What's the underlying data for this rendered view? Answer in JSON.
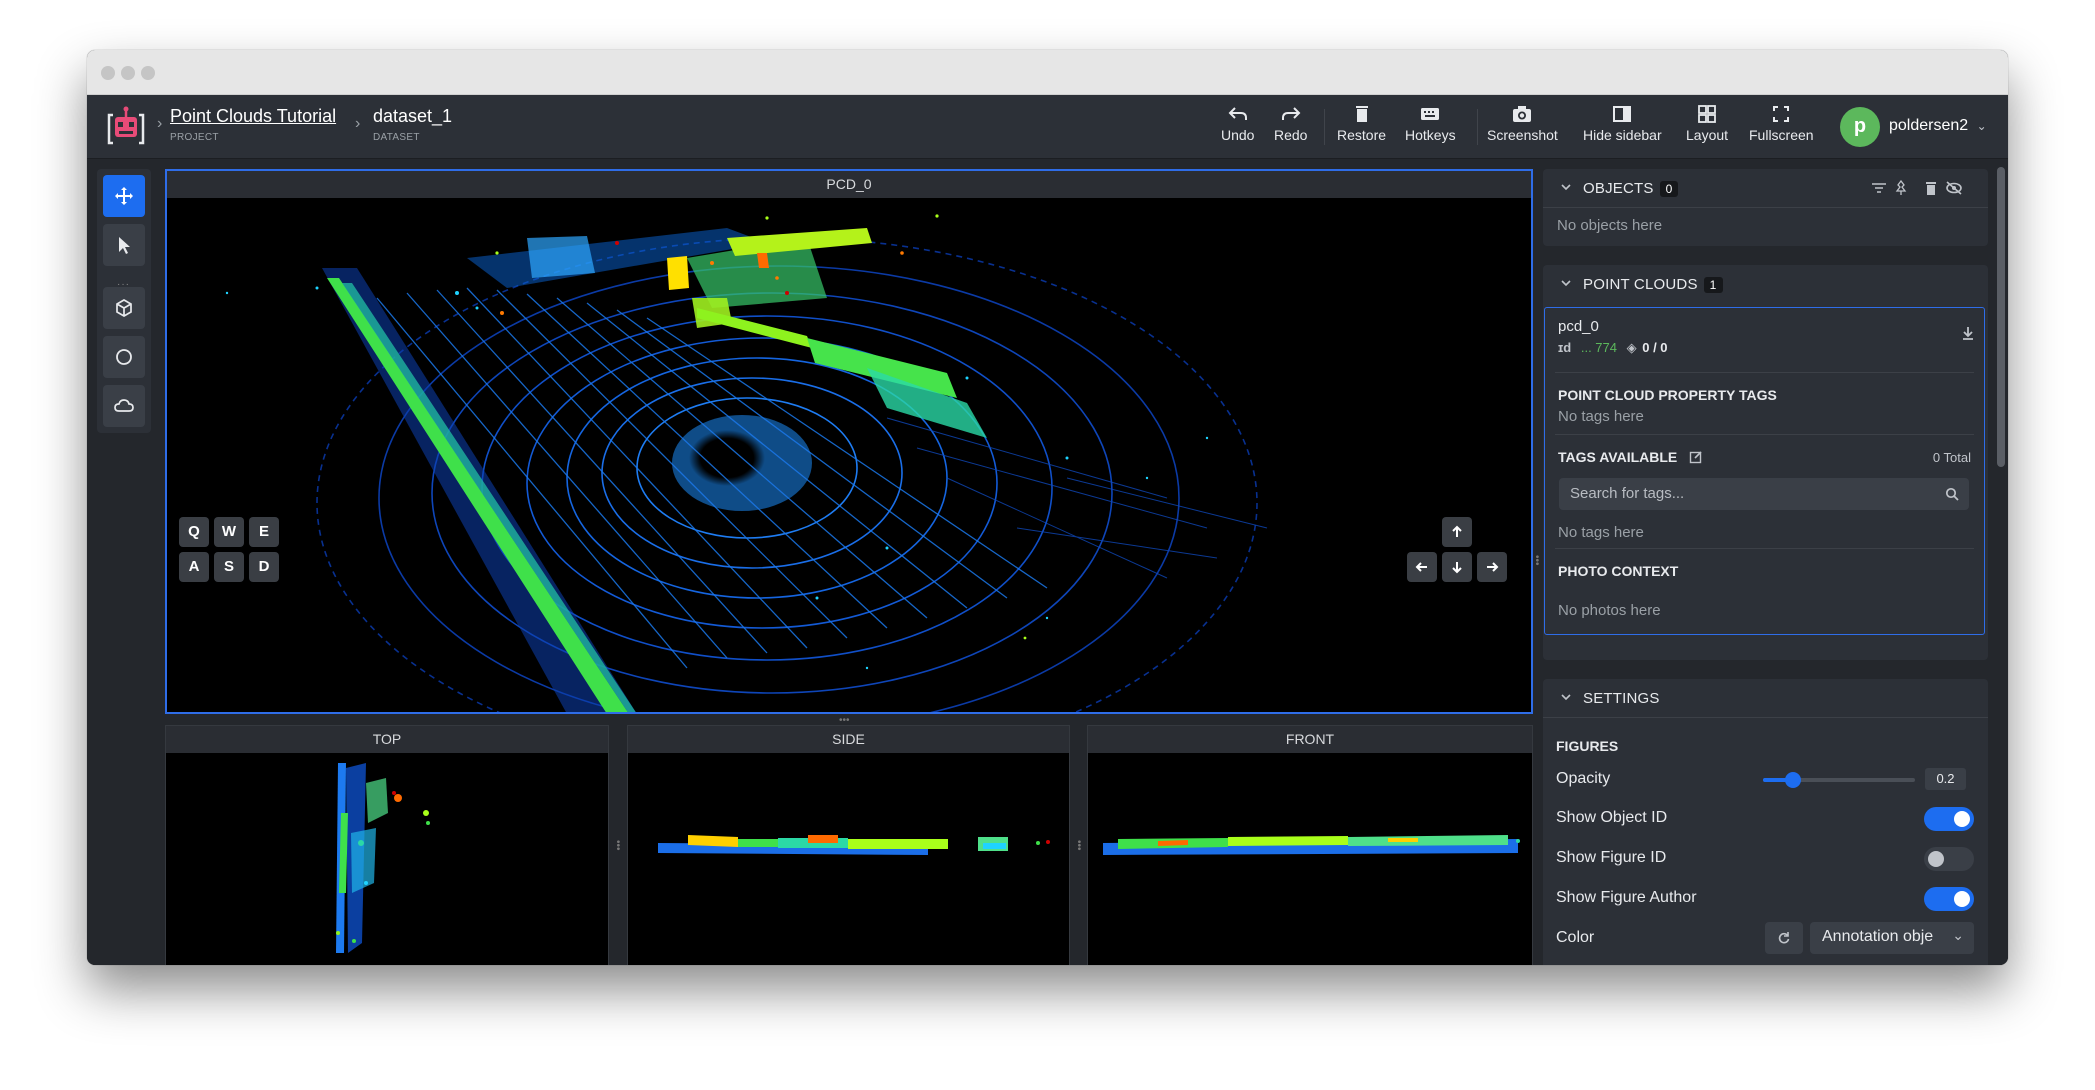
{
  "breadcrumb": {
    "project_title": "Point Clouds Tutorial",
    "project_sub": "PROJECT",
    "dataset_title": "dataset_1",
    "dataset_sub": "DATASET"
  },
  "toolbar": {
    "undo": "Undo",
    "redo": "Redo",
    "restore": "Restore",
    "hotkeys": "Hotkeys",
    "screenshot": "Screenshot",
    "hide_sidebar": "Hide sidebar",
    "layout": "Layout",
    "fullscreen": "Fullscreen"
  },
  "user": {
    "initial": "p",
    "name": "poldersen2"
  },
  "tools": [
    "move-tool",
    "pointer-tool",
    "cuboid-tool",
    "point-tool",
    "cloud-tool"
  ],
  "viewports": {
    "main": "PCD_0",
    "top": "TOP",
    "side": "SIDE",
    "front": "FRONT"
  },
  "keys": [
    "Q",
    "W",
    "E",
    "A",
    "S",
    "D"
  ],
  "sidebar": {
    "objects": {
      "title": "OBJECTS",
      "count": "0",
      "empty": "No objects here"
    },
    "pointclouds": {
      "title": "POINT CLOUDS",
      "count": "1",
      "item_name": "pcd_0",
      "item_id": "... 774",
      "item_figures": "0 / 0",
      "property_tags_title": "POINT CLOUD PROPERTY TAGS",
      "property_tags_empty": "No tags here",
      "tags_available_title": "TAGS AVAILABLE",
      "tags_total": "0 Total",
      "search_placeholder": "Search for tags...",
      "tags_empty": "No tags here",
      "photo_context_title": "PHOTO CONTEXT",
      "photo_empty": "No photos here"
    },
    "settings": {
      "title": "SETTINGS",
      "figures_title": "FIGURES",
      "opacity_label": "Opacity",
      "opacity_value": "0.2",
      "opacity_fraction": 0.2,
      "show_object_id": "Show Object ID",
      "show_object_id_on": true,
      "show_figure_id": "Show Figure ID",
      "show_figure_id_on": false,
      "show_figure_author": "Show Figure Author",
      "show_figure_author_on": true,
      "color_label": "Color",
      "color_select": "Annotation obje"
    }
  },
  "colors": {
    "accent": "#1d6df0",
    "avatar": "#5cb85c"
  }
}
